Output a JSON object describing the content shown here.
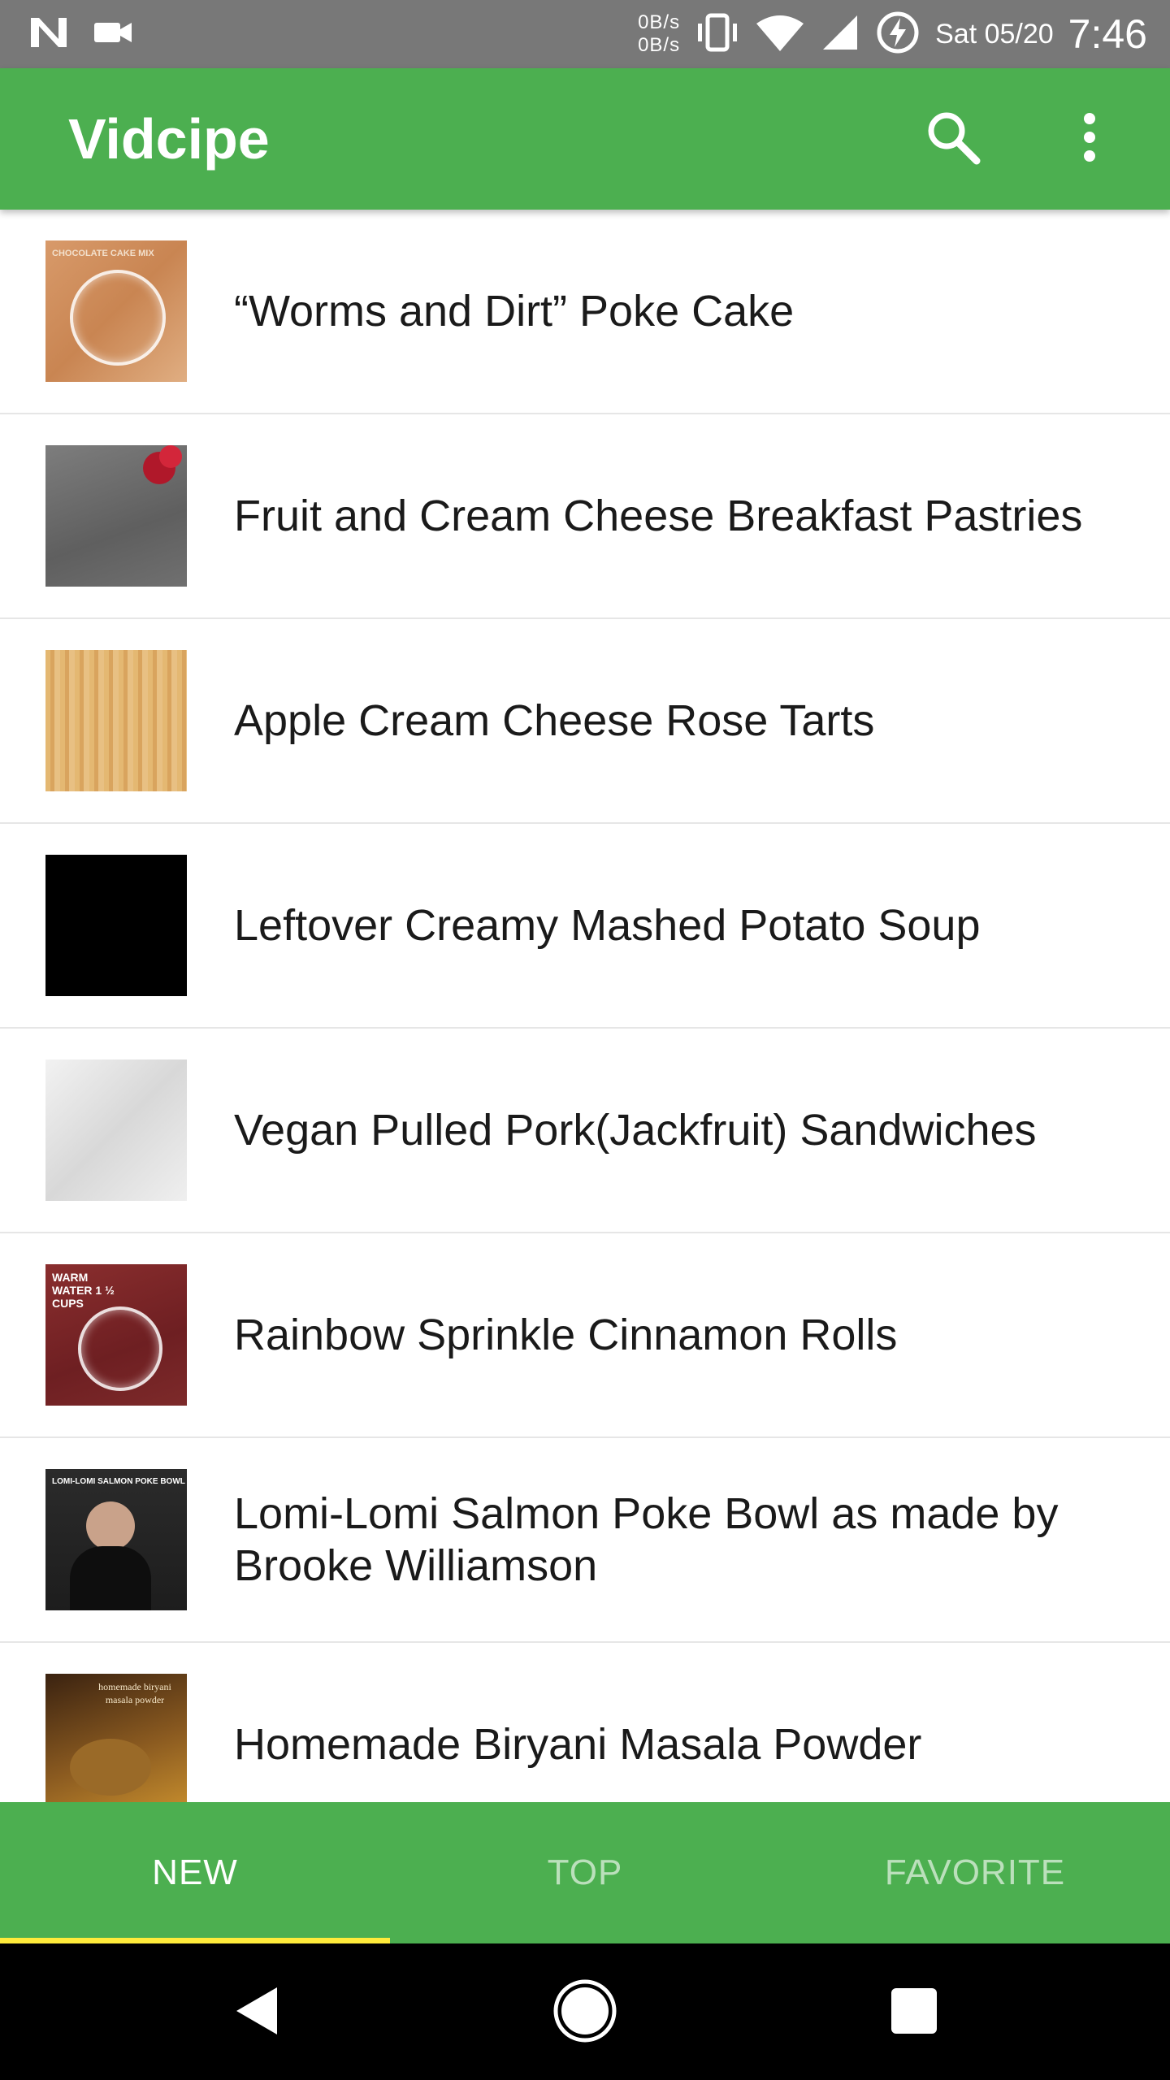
{
  "status_bar": {
    "net_up": "0B/s",
    "net_down": "0B/s",
    "date": "Sat 05/20",
    "time": "7:46",
    "left_icons": [
      "n-icon",
      "video-camera-icon"
    ],
    "right_icons": [
      "vibrate-icon",
      "wifi-icon",
      "cell-signal-icon",
      "battery-charging-icon"
    ]
  },
  "app_bar": {
    "title": "Vidcipe",
    "color": "#4caf50"
  },
  "recipes": [
    {
      "title": "“Worms and Dirt” Poke Cake",
      "thumb_text": "CHOCOLATE CAKE MIX"
    },
    {
      "title": "Fruit and Cream Cheese Breakfast Pastries",
      "thumb_text": ""
    },
    {
      "title": "Apple Cream Cheese Rose Tarts",
      "thumb_text": ""
    },
    {
      "title": "Leftover Creamy Mashed Potato Soup",
      "thumb_text": ""
    },
    {
      "title": "Vegan Pulled Pork(Jackfruit) Sandwiches",
      "thumb_text": ""
    },
    {
      "title": "Rainbow Sprinkle Cinnamon Rolls",
      "thumb_text": "WARM WATER 1 ½ CUPS"
    },
    {
      "title": "Lomi-Lomi Salmon Poke Bowl as made by Brooke Williamson",
      "thumb_text": "LOMI-LOMI SALMON POKE BOWL"
    },
    {
      "title": "Homemade Biryani Masala Powder",
      "thumb_text": "homemade biryani masala powder"
    }
  ],
  "tabs": [
    {
      "label": "NEW",
      "active": true
    },
    {
      "label": "TOP",
      "active": false
    },
    {
      "label": "FAVORITE",
      "active": false
    }
  ],
  "tab_indicator_color": "#ffeb3b",
  "nav_bar": [
    "back-icon",
    "home-icon",
    "recents-icon"
  ]
}
